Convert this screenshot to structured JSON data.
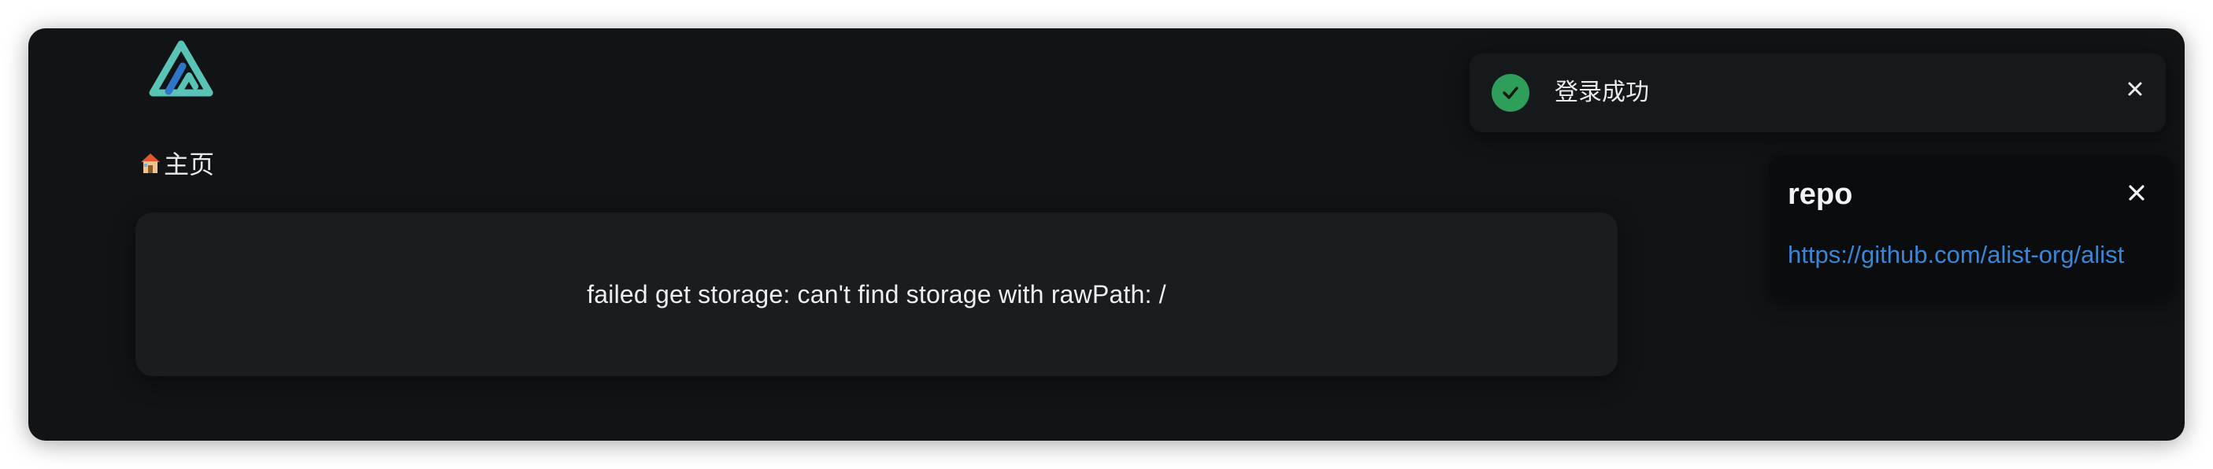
{
  "header": {
    "logo_icon": "alist-logo-icon"
  },
  "breadcrumb": {
    "home_icon": "house-icon",
    "home_label": "主页"
  },
  "main": {
    "error_message": "failed get storage: can't find storage with rawPath: /"
  },
  "toast": {
    "status_icon": "check-circle-icon",
    "message": "登录成功",
    "status_color": "#2f9e5a",
    "close_icon": "close-icon"
  },
  "notice": {
    "title": "repo",
    "link_text": "https://github.com/alist-org/alist",
    "link_color": "#3a86d8",
    "close_icon": "close-icon"
  }
}
